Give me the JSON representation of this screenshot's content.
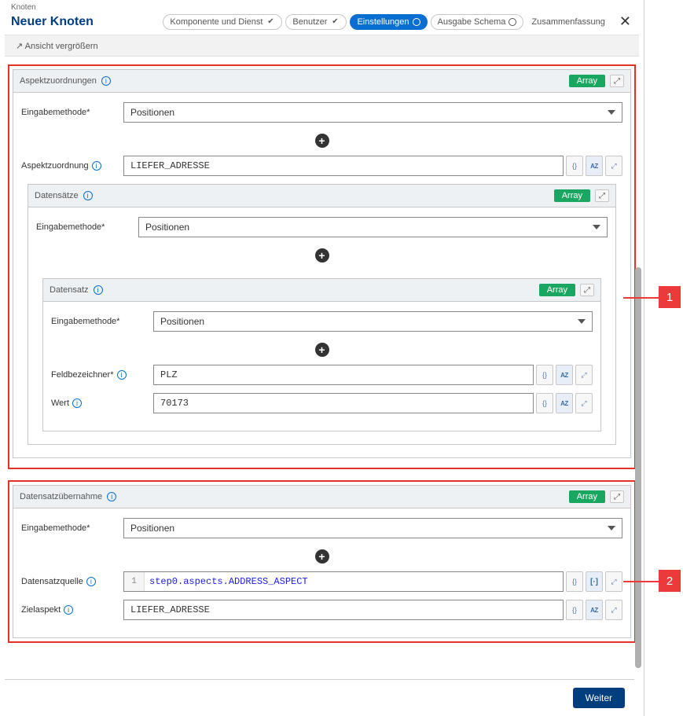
{
  "breadcrumb": "Knoten",
  "page_title": "Neuer Knoten",
  "wizard": {
    "steps": [
      {
        "label": "Komponente und Dienst",
        "done": true,
        "active": false
      },
      {
        "label": "Benutzer",
        "done": true,
        "active": false
      },
      {
        "label": "Einstellungen",
        "done": false,
        "active": true
      },
      {
        "label": "Ausgabe Schema",
        "done": false,
        "active": false
      },
      {
        "label": "Zusammenfassung",
        "done": false,
        "active": false,
        "plain": true
      }
    ]
  },
  "toolbar": {
    "expand_view": "Ansicht vergrößern"
  },
  "labels": {
    "eingabemethode": "Eingabemethode*",
    "aspektzuordnung": "Aspektzuordnung",
    "feldbezeichner": "Feldbezeichner*",
    "wert": "Wert",
    "datensatzquelle": "Datensatzquelle",
    "zielaspekt": "Zielaspekt",
    "array": "Array"
  },
  "select_options": {
    "positionen": "Positionen"
  },
  "section1": {
    "header": "Aspektzuordnungen",
    "eingabemethode": "Positionen",
    "aspektzuordnung_value": "LIEFER_ADRESSE",
    "datensaetze": {
      "header": "Datensätze",
      "eingabemethode": "Positionen",
      "datensatz": {
        "header": "Datensatz",
        "eingabemethode": "Positionen",
        "feldbezeichner": "PLZ",
        "wert": "70173"
      }
    }
  },
  "section2": {
    "header": "Datensatzübernahme",
    "eingabemethode": "Positionen",
    "datensatzquelle": "step0.aspects.ADDRESS_ASPECT",
    "lineno": "1",
    "zielaspekt": "LIEFER_ADRESSE"
  },
  "footer": {
    "next": "Weiter"
  },
  "callouts": {
    "one": "1",
    "two": "2"
  }
}
